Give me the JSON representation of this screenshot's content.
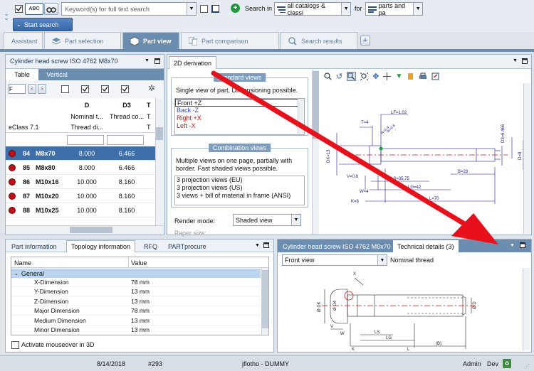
{
  "toolbar": {
    "abc_label": "ABC",
    "search_placeholder": "Keyword(s) for full text search",
    "search_in_label": "Search in",
    "catalog_value": "all catalogs & classi",
    "for_label": "for",
    "for_value": "parts and pa",
    "start_search": "Start search"
  },
  "tabs": [
    {
      "label": "Assistant",
      "active": false
    },
    {
      "label": "Part selection",
      "active": false
    },
    {
      "label": "Part view",
      "active": true
    },
    {
      "label": "Part comparison",
      "active": false
    },
    {
      "label": "Search results",
      "active": false
    }
  ],
  "left_panel": {
    "title": "Cylinder head screw ISO 4762 M8x70",
    "subtabs": [
      "Table",
      "Vertical"
    ],
    "filter_value": "F",
    "classification": "eClass 7.1",
    "columns": [
      {
        "key": "D",
        "desc": "Nominal t...",
        "sub": "Thread di..."
      },
      {
        "key": "D3",
        "desc": "Thread co...",
        "sub": ""
      },
      {
        "key": "T",
        "desc": "T",
        "sub": "T"
      }
    ],
    "rows": [
      {
        "num": "84",
        "name": "M8x70",
        "d": "8.000",
        "d3": "6.466",
        "selected": true
      },
      {
        "num": "85",
        "name": "M8x80",
        "d": "8.000",
        "d3": "6.466",
        "selected": false
      },
      {
        "num": "86",
        "name": "M10x16",
        "d": "10.000",
        "d3": "8.160",
        "selected": false
      },
      {
        "num": "87",
        "name": "M10x20",
        "d": "10.000",
        "d3": "8.160",
        "selected": false
      },
      {
        "num": "88",
        "name": "M10x25",
        "d": "10.000",
        "d3": "8.160",
        "selected": false
      }
    ]
  },
  "derivation": {
    "tab": "2D derivation",
    "standard_legend": "Standard views",
    "standard_desc": "Single view of part, Dimensioning possible.",
    "standard_items": [
      {
        "label": "Front +Z",
        "color": "#000000"
      },
      {
        "label": "Back -Z",
        "color": "#3050c0"
      },
      {
        "label": "Right +X",
        "color": "#d01010"
      },
      {
        "label": "Left -X",
        "color": "#d01010"
      }
    ],
    "combo_legend": "Combination views",
    "combo_desc": "Multiple views on one page, partially with border. Fast shaded views possible.",
    "combo_items": [
      "3 projection views (EU)",
      "3 projection views (US)",
      "3 views + bill of material in frame (ANSI)"
    ],
    "render_label": "Render mode:",
    "render_value": "Shaded view",
    "paper_label": "Paper size:"
  },
  "drawing_labels": {
    "lf": "LF=1.02",
    "t": "T=4",
    "d3": "D3=6.466",
    "dk": "DK=13",
    "d": "D=8",
    "v": "V=0.8",
    "w": "W=4",
    "k": "K=8",
    "ls": "LS=35.75",
    "lg": "LG=42",
    "b": "B=28",
    "l": "L=70"
  },
  "bottom_left": {
    "tabs": [
      "Part information",
      "Topology information",
      "RFQ",
      "PARTprocure"
    ],
    "col_name": "Name",
    "col_value": "Value",
    "group": "General",
    "rows": [
      {
        "name": "X-Dimension",
        "value": "78 mm"
      },
      {
        "name": "Y-Dimension",
        "value": "13 mm"
      },
      {
        "name": "Z-Dimension",
        "value": "13 mm"
      },
      {
        "name": "Major Dimension",
        "value": "78 mm"
      },
      {
        "name": "Medium Dimension",
        "value": "13 mm"
      },
      {
        "name": "Minor Dimension",
        "value": "13 mm"
      }
    ],
    "mouseover_label": "Activate mouseover in 3D"
  },
  "bottom_right": {
    "tabs": [
      "Cylinder head screw ISO 4762 M8x70",
      "Technical details (3)"
    ],
    "view_value": "Front view",
    "nominal_label": "Nominal thread"
  },
  "status": {
    "date": "8/14/2018",
    "id": "#293",
    "user": "jflotho - DUMMY",
    "role": "Admin",
    "mode": "Dev"
  }
}
